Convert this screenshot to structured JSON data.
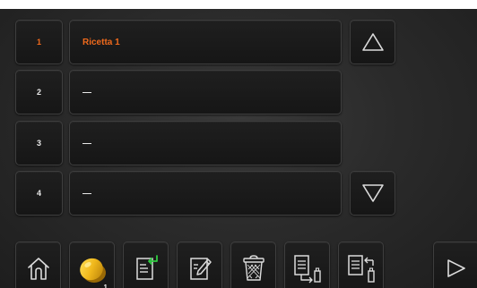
{
  "colors": {
    "active_text": "#f06a1c",
    "text": "#e8e8e8",
    "icon_stroke": "#dcdcdc",
    "accent_green": "#2ecc40",
    "coin": "#f0b81c"
  },
  "recipes": [
    {
      "number": "1",
      "name": "Ricetta 1",
      "selected": true
    },
    {
      "number": "2",
      "name": "—",
      "selected": false
    },
    {
      "number": "3",
      "name": "—",
      "selected": false
    },
    {
      "number": "4",
      "name": "—",
      "selected": false
    }
  ],
  "toolbar": {
    "items": [
      {
        "icon": "home-icon"
      },
      {
        "icon": "product-icon",
        "badge": "1"
      },
      {
        "icon": "new-file-icon"
      },
      {
        "icon": "edit-file-icon"
      },
      {
        "icon": "trash-icon"
      },
      {
        "icon": "export-icon"
      },
      {
        "icon": "import-icon"
      },
      {
        "icon": "play-icon"
      }
    ]
  }
}
